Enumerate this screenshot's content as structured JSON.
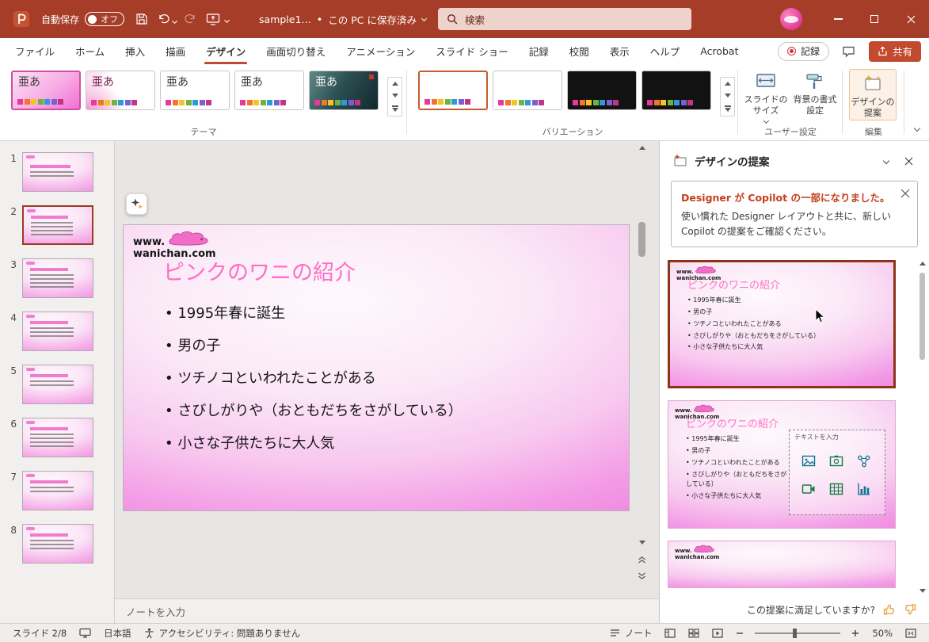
{
  "colors": {
    "titlebar_red": "#A63D28",
    "accent_red": "#C24A2F",
    "slide_title_pink": "#FF6EC7",
    "selected_card_border": "#8B3418",
    "record_red": "#D13438"
  },
  "titlebar": {
    "autosave_label": "自動保存",
    "autosave_state": "オフ",
    "doc_title": "sample1…",
    "separator": "•",
    "saved_status": "この PC に保存済み",
    "search_placeholder": "検索"
  },
  "ribbon": {
    "tabs": [
      "ファイル",
      "ホーム",
      "挿入",
      "描画",
      "デザイン",
      "画面切り替え",
      "アニメーション",
      "スライド ショー",
      "記録",
      "校閲",
      "表示",
      "ヘルプ",
      "Acrobat"
    ],
    "record_label": "記録",
    "share_label": "共有",
    "theme_sample": "亜あ",
    "groups": {
      "themes": "テーマ",
      "variants": "バリエーション",
      "customize": "ユーザー設定",
      "editing": "編集"
    },
    "buttons": {
      "slide_size": "スライドのサイズ",
      "format_background": "背景の書式設定",
      "design_ideas": "デザインの提案"
    }
  },
  "thumbs": {
    "numbers": [
      "1",
      "2",
      "3",
      "4",
      "5",
      "6",
      "7",
      "8"
    ],
    "active": "2"
  },
  "slide": {
    "logo_line1": "www.",
    "logo_line2": "wanichan.com",
    "title": "ピンクのワニの紹介",
    "bullets": [
      "1995年春に誕生",
      "男の子",
      "ツチノコといわれたことがある",
      "さびしがりや（おともだちをさがしている）",
      "小さな子供たちに大人気"
    ]
  },
  "notes": {
    "placeholder": "ノートを入力"
  },
  "pane": {
    "title": "デザインの提案",
    "notice_title": "Designer が Copilot の一部になりました。",
    "notice_body": "使い慣れた Designer レイアウトと共に、新しい Copilot の提案をご確認ください。",
    "placeholder_label": "テキストを入力",
    "feedback_question": "この提案に満足していますか?"
  },
  "statusbar": {
    "slide_indicator": "スライド 2/8",
    "language": "日本語",
    "accessibility": "アクセシビリティ: 問題ありません",
    "notes_label": "ノート",
    "zoom_percent": "50%"
  }
}
